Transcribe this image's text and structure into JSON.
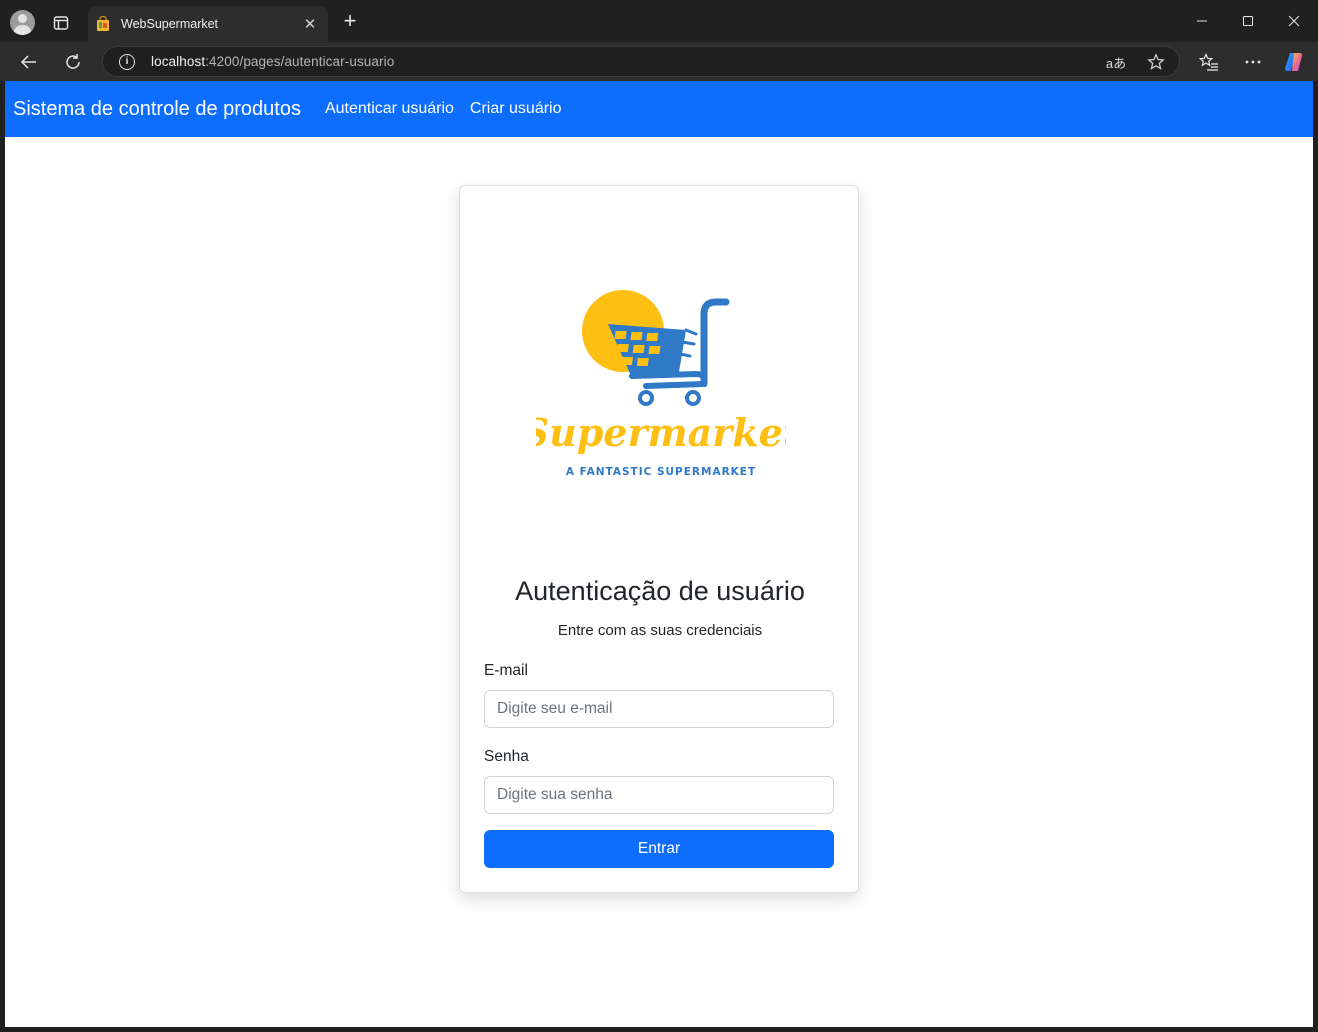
{
  "browser": {
    "tab_title": "WebSupermarket",
    "tab_close": "✕",
    "new_tab": "+",
    "url_host": "localhost",
    "url_rest": ":4200/pages/autenticar-usuario",
    "read_aloud_label": "aあ"
  },
  "navbar": {
    "brand": "Sistema de controle de produtos",
    "links": [
      "Autenticar usuário",
      "Criar usuário"
    ]
  },
  "logo": {
    "wordmark": "Supermarket",
    "tagline": "A FANTASTIC SUPERMARKET",
    "colors": {
      "yellow": "#fdbf12",
      "blue": "#2f79c6"
    }
  },
  "form": {
    "title": "Autenticação de usuário",
    "subtitle": "Entre com as suas credenciais",
    "email_label": "E-mail",
    "email_placeholder": "Digite seu e-mail",
    "password_label": "Senha",
    "password_placeholder": "Digite sua senha",
    "submit_label": "Entrar"
  },
  "colors": {
    "primary": "#0d6efd"
  }
}
